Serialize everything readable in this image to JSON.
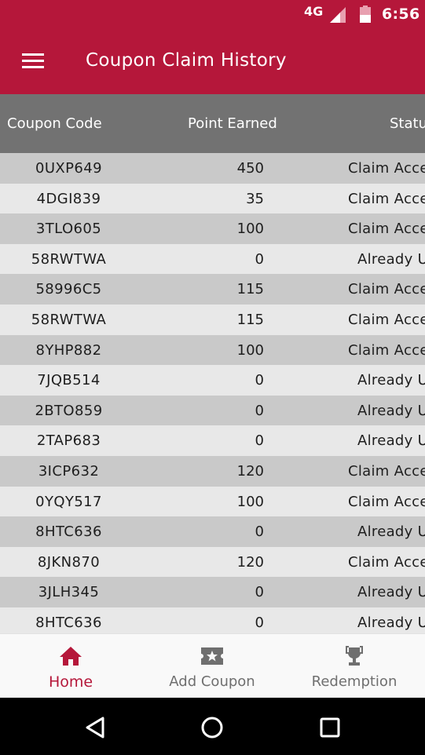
{
  "status_bar": {
    "network": "4G",
    "time": "6:56",
    "icons": [
      "signal-icon",
      "battery-icon"
    ]
  },
  "app_bar": {
    "title": "Coupon Claim History",
    "menu_icon": "hamburger-menu-icon"
  },
  "table": {
    "columns": [
      "Coupon Code",
      "Point Earned",
      "Status"
    ],
    "rows": [
      {
        "code": "0UXP649",
        "points": "450",
        "status": "Claim Accepted"
      },
      {
        "code": "4DGI839",
        "points": "35",
        "status": "Claim Accepted"
      },
      {
        "code": "3TLO605",
        "points": "100",
        "status": "Claim Accepted"
      },
      {
        "code": "58RWTWA",
        "points": "0",
        "status": "Already Used"
      },
      {
        "code": "58996C5",
        "points": "115",
        "status": "Claim Accepted"
      },
      {
        "code": "58RWTWA",
        "points": "115",
        "status": "Claim Accepted"
      },
      {
        "code": "8YHP882",
        "points": "100",
        "status": "Claim Accepted"
      },
      {
        "code": "7JQB514",
        "points": "0",
        "status": "Already Used"
      },
      {
        "code": "2BTO859",
        "points": "0",
        "status": "Already Used"
      },
      {
        "code": "2TAP683",
        "points": "0",
        "status": "Already Used"
      },
      {
        "code": "3ICP632",
        "points": "120",
        "status": "Claim Accepted"
      },
      {
        "code": "0YQY517",
        "points": "100",
        "status": "Claim Accepted"
      },
      {
        "code": "8HTC636",
        "points": "0",
        "status": "Already Used"
      },
      {
        "code": "8JKN870",
        "points": "120",
        "status": "Claim Accepted"
      },
      {
        "code": "3JLH345",
        "points": "0",
        "status": "Already Used"
      },
      {
        "code": "8HTC636",
        "points": "0",
        "status": "Already Used"
      }
    ]
  },
  "bottom_nav": {
    "items": [
      {
        "label": "Home",
        "icon": "home-icon",
        "active": true
      },
      {
        "label": "Add Coupon",
        "icon": "ticket-star-icon",
        "active": false
      },
      {
        "label": "Redemption",
        "icon": "trophy-icon",
        "active": false
      }
    ]
  },
  "system_nav": {
    "items": [
      "back-icon",
      "home-circle-icon",
      "recents-icon"
    ]
  },
  "colors": {
    "primary": "#b5173a",
    "header_gray": "#727272",
    "row_dark": "#c9c9c9",
    "row_light": "#e8e8e8",
    "inactive_nav": "#6f6f6f"
  }
}
